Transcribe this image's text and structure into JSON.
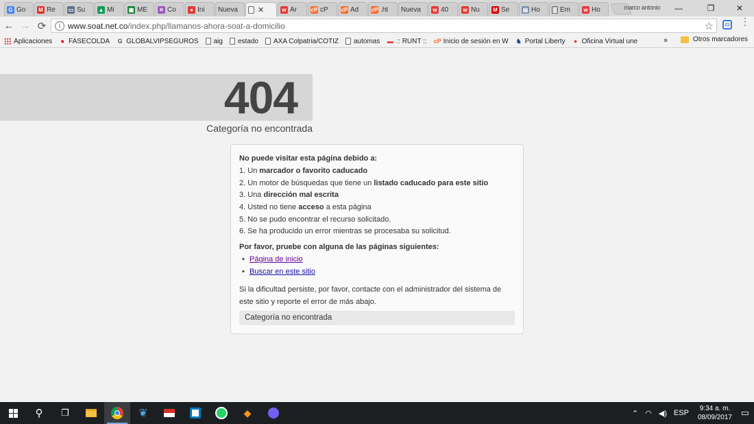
{
  "browser": {
    "tabs": [
      {
        "label": "Go",
        "icon": "google-icon",
        "color": "#4285f4",
        "glyph": "G"
      },
      {
        "label": "Re",
        "icon": "gmail-icon",
        "color": "#d93025",
        "glyph": "M"
      },
      {
        "label": "Su",
        "icon": "monitor-icon",
        "color": "#5f6f86",
        "glyph": "▭"
      },
      {
        "label": "Mi",
        "icon": "drive-icon",
        "color": "#0f9d58",
        "glyph": "▲"
      },
      {
        "label": "ME",
        "icon": "sheets-icon",
        "color": "#188038",
        "glyph": "▦"
      },
      {
        "label": "Co",
        "icon": "clickup-icon",
        "color": "#9b59b6",
        "glyph": "✕"
      },
      {
        "label": "Ini",
        "icon": "drop-icon",
        "color": "#e53935",
        "glyph": "●"
      },
      {
        "label": "Nueva",
        "icon": "none",
        "color": "#cfcfcf",
        "glyph": ""
      },
      {
        "label": "",
        "icon": "page-icon",
        "color": "#888888",
        "glyph": "▯",
        "active": true
      },
      {
        "label": "Ár",
        "icon": "w-icon",
        "color": "#e53935",
        "glyph": "w"
      },
      {
        "label": "cP",
        "icon": "cpanel-icon",
        "color": "#ff6c2c",
        "glyph": "cP"
      },
      {
        "label": "Ad",
        "icon": "cpanel-icon",
        "color": "#ff6c2c",
        "glyph": "cP"
      },
      {
        "label": ".ht",
        "icon": "cpanel-icon",
        "color": "#ff6c2c",
        "glyph": "cP"
      },
      {
        "label": "Nueva",
        "icon": "none",
        "color": "#cfcfcf",
        "glyph": ""
      },
      {
        "label": "40",
        "icon": "w-icon",
        "color": "#e53935",
        "glyph": "w"
      },
      {
        "label": "Nu",
        "icon": "w-icon",
        "color": "#e53935",
        "glyph": "w"
      },
      {
        "label": "Se",
        "icon": "m-icon",
        "color": "#d50000",
        "glyph": "M"
      },
      {
        "label": "Ho",
        "icon": "grid-icon",
        "color": "#7b8fa8",
        "glyph": "▤"
      },
      {
        "label": "Em",
        "icon": "page-icon",
        "color": "#888888",
        "glyph": "▯"
      },
      {
        "label": "Ho",
        "icon": "w-icon",
        "color": "#e53935",
        "glyph": "w"
      }
    ],
    "active_tab_close": "✕",
    "user_name": "marco antonio",
    "window_controls": {
      "minimize": "—",
      "restore": "❐",
      "close": "✕"
    },
    "nav": {
      "back": "←",
      "forward": "→",
      "reload": "⟳"
    },
    "url": {
      "host": "www.soat.net.co",
      "path": "/index.php/llamanos-ahora-soat-a-domicilio"
    },
    "star": "☆",
    "menu": "⋮",
    "bookmarks": [
      {
        "label": "Aplicaciones",
        "icon": "apps-icon"
      },
      {
        "label": "FASECOLDA",
        "icon": "vodafone-icon",
        "glyph": "●",
        "color": "#e60000"
      },
      {
        "label": "GLOBALVIPSEGUROS",
        "icon": "google-icon",
        "glyph": "G",
        "color": "#555555"
      },
      {
        "label": "aig",
        "icon": "page-icon"
      },
      {
        "label": "estado",
        "icon": "page-icon"
      },
      {
        "label": "AXA Colpatria/COTIZ",
        "icon": "page-icon"
      },
      {
        "label": "automas",
        "icon": "page-icon"
      },
      {
        "label": ":: RUNT ::",
        "icon": "runt-icon",
        "glyph": "▬",
        "color": "#e53935"
      },
      {
        "label": "Inicio de sesión en W",
        "icon": "cpanel-icon",
        "glyph": "cP",
        "color": "#ff6c2c"
      },
      {
        "label": "Portal Liberty",
        "icon": "liberty-icon",
        "glyph": "♞",
        "color": "#1d4f91"
      },
      {
        "label": "Oficina Virtual une",
        "icon": "une-icon",
        "glyph": "●",
        "color": "#e53935"
      }
    ],
    "bookmarks_more": "»",
    "other_bookmarks": "Otros marcadores"
  },
  "page": {
    "error_code": "404",
    "error_subtitle": "Categoría no encontrada",
    "reasons_heading": "No puede visitar esta página debido a:",
    "reasons": [
      {
        "num": "1.",
        "pre": "Un ",
        "bold": "marcador o favorito caducado",
        "post": ""
      },
      {
        "num": "2.",
        "pre": "Un motor de búsquedas que tiene un ",
        "bold": "listado caducado para este sitio",
        "post": ""
      },
      {
        "num": "3.",
        "pre": "Una ",
        "bold": "dirección mal escrita",
        "post": ""
      },
      {
        "num": "4.",
        "pre": "Usted no tiene ",
        "bold": "acceso",
        "post": " a esta página"
      },
      {
        "num": "5.",
        "pre": "No se pudo encontrar el recurso solicitado.",
        "bold": "",
        "post": ""
      },
      {
        "num": "6.",
        "pre": "Se ha producido un error mientras se procesaba su solicitud.",
        "bold": "",
        "post": ""
      }
    ],
    "links_heading": "Por favor, pruebe con alguna de las páginas siguientes:",
    "links": [
      {
        "label": "Página de inicio",
        "visited": true
      },
      {
        "label": "Buscar en este sitio",
        "visited": false
      }
    ],
    "note": "Si la dificultad persiste, por favor, contacte con el administrador del sistema de este sitio y reporte el error de más abajo.",
    "error_message": "Categoría no encontrada"
  },
  "taskbar": {
    "language": "ESP",
    "time": "9:34 a. m.",
    "date": "08/09/2017"
  }
}
